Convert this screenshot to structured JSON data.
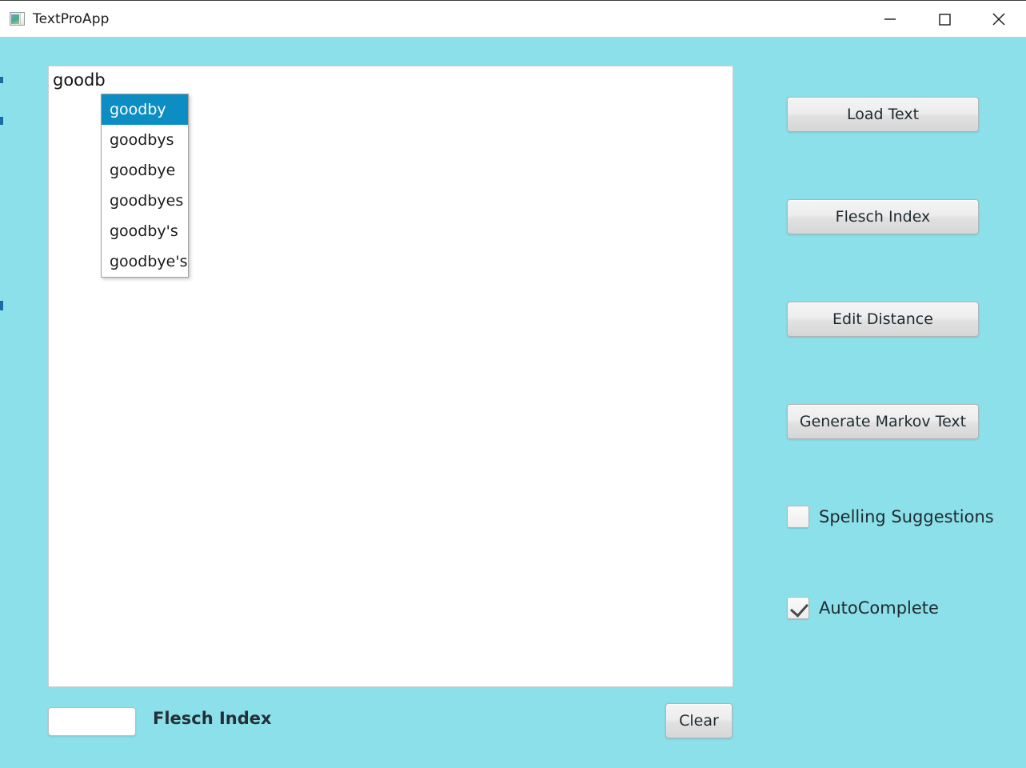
{
  "window": {
    "title": "TextProApp",
    "icon": "app-image-icon",
    "background_color": "#8ce0ea",
    "controls": [
      {
        "name": "minimize",
        "glyph": "minimize-icon"
      },
      {
        "name": "maximize",
        "glyph": "maximize-icon"
      },
      {
        "name": "close",
        "glyph": "close-icon"
      }
    ]
  },
  "editor": {
    "text": "goodb",
    "caret_visible": true
  },
  "autocomplete": {
    "visible": true,
    "highlight_color": "#0c8ec4",
    "selected_index": 0,
    "items": [
      {
        "label": "goodby"
      },
      {
        "label": "goodbys"
      },
      {
        "label": "goodbye"
      },
      {
        "label": "goodbyes"
      },
      {
        "label": "goodby's"
      },
      {
        "label": "goodbye's"
      }
    ]
  },
  "sidebar": {
    "buttons": [
      {
        "label": "Load Text"
      },
      {
        "label": "Flesch Index"
      },
      {
        "label": "Edit Distance"
      },
      {
        "label": "Generate Markov Text"
      }
    ],
    "checkboxes": [
      {
        "label": "Spelling Suggestions",
        "checked": false
      },
      {
        "label": "AutoComplete",
        "checked": true
      }
    ]
  },
  "bottom_bar": {
    "flesch_value": "",
    "flesch_placeholder": "",
    "flesch_label": "Flesch Index",
    "clear_label": "Clear"
  }
}
